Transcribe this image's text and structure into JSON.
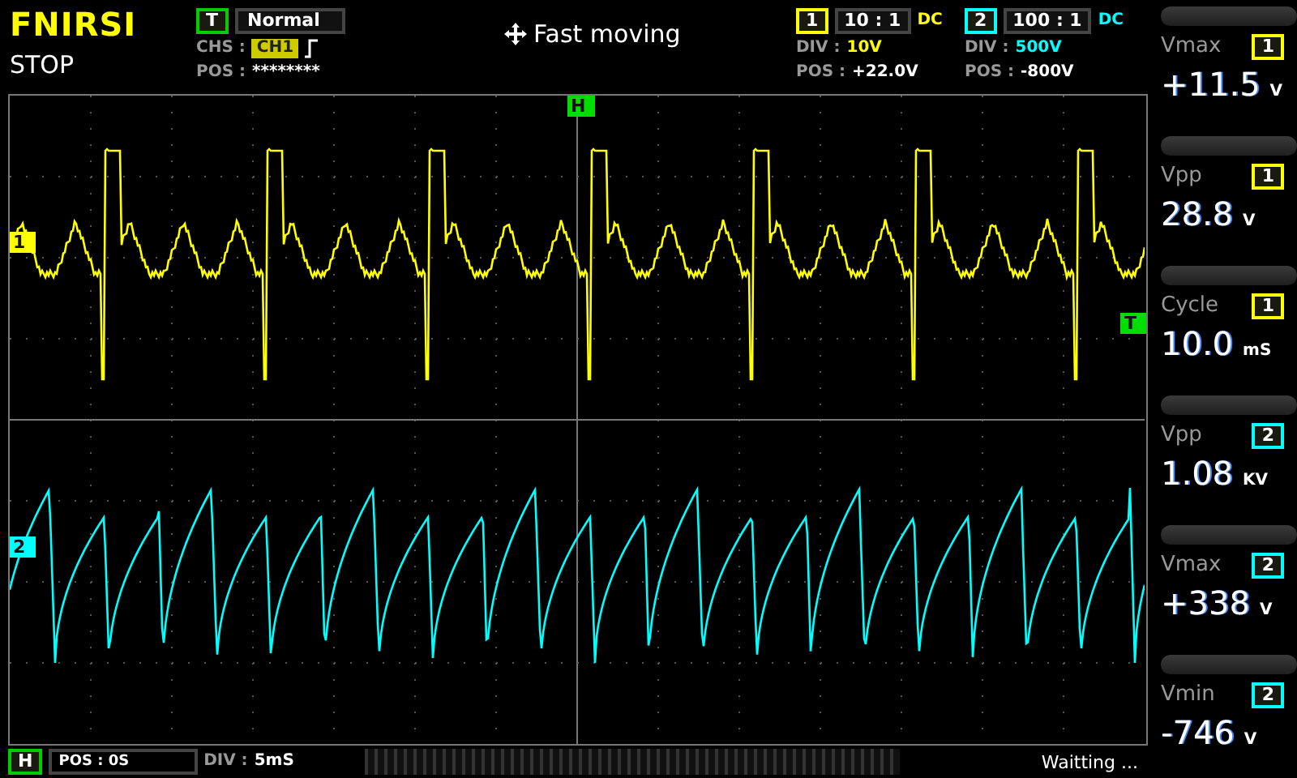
{
  "brand": "FNIRSI",
  "run_state": "STOP",
  "trigger": {
    "badge": "T",
    "mode": "Normal",
    "chs_label": "CHS :",
    "source": "CH1",
    "pos_label": "POS :",
    "pos_value": "********"
  },
  "status_text": "Fast moving",
  "channels": [
    {
      "number": "1",
      "probe": "10 : 1",
      "coupling": "DC",
      "div_label": "DIV :",
      "div": "10V",
      "pos_label": "POS :",
      "pos": "+22.0V",
      "color": "#ffff00",
      "marker": "1"
    },
    {
      "number": "2",
      "probe": "100 : 1",
      "coupling": "DC",
      "div_label": "DIV :",
      "div": "500V",
      "pos_label": "POS :",
      "pos": "-800V",
      "color": "#00ffff",
      "marker": "2"
    }
  ],
  "plot": {
    "time_marker": "H",
    "trigger_marker": "T"
  },
  "measurements": [
    {
      "name": "Vmax",
      "channel": "1",
      "value": "+11.5",
      "unit": "V",
      "color": "#ffff00"
    },
    {
      "name": "Vpp",
      "channel": "1",
      "value": "28.8",
      "unit": "V",
      "color": "#ffff00"
    },
    {
      "name": "Cycle",
      "channel": "1",
      "value": "10.0",
      "unit": "mS",
      "color": "#ffff00"
    },
    {
      "name": "Vpp",
      "channel": "2",
      "value": "1.08",
      "unit": "KV",
      "color": "#00ffff"
    },
    {
      "name": "Vmax",
      "channel": "2",
      "value": "+338",
      "unit": "V",
      "color": "#00ffff"
    },
    {
      "name": "Vmin",
      "channel": "2",
      "value": "-746",
      "unit": "V",
      "color": "#00ffff"
    }
  ],
  "timebase": {
    "badge": "H",
    "pos": "POS : 0S",
    "div_label": "DIV :",
    "div": "5mS"
  },
  "acquisition_status": "Waitting ..."
}
